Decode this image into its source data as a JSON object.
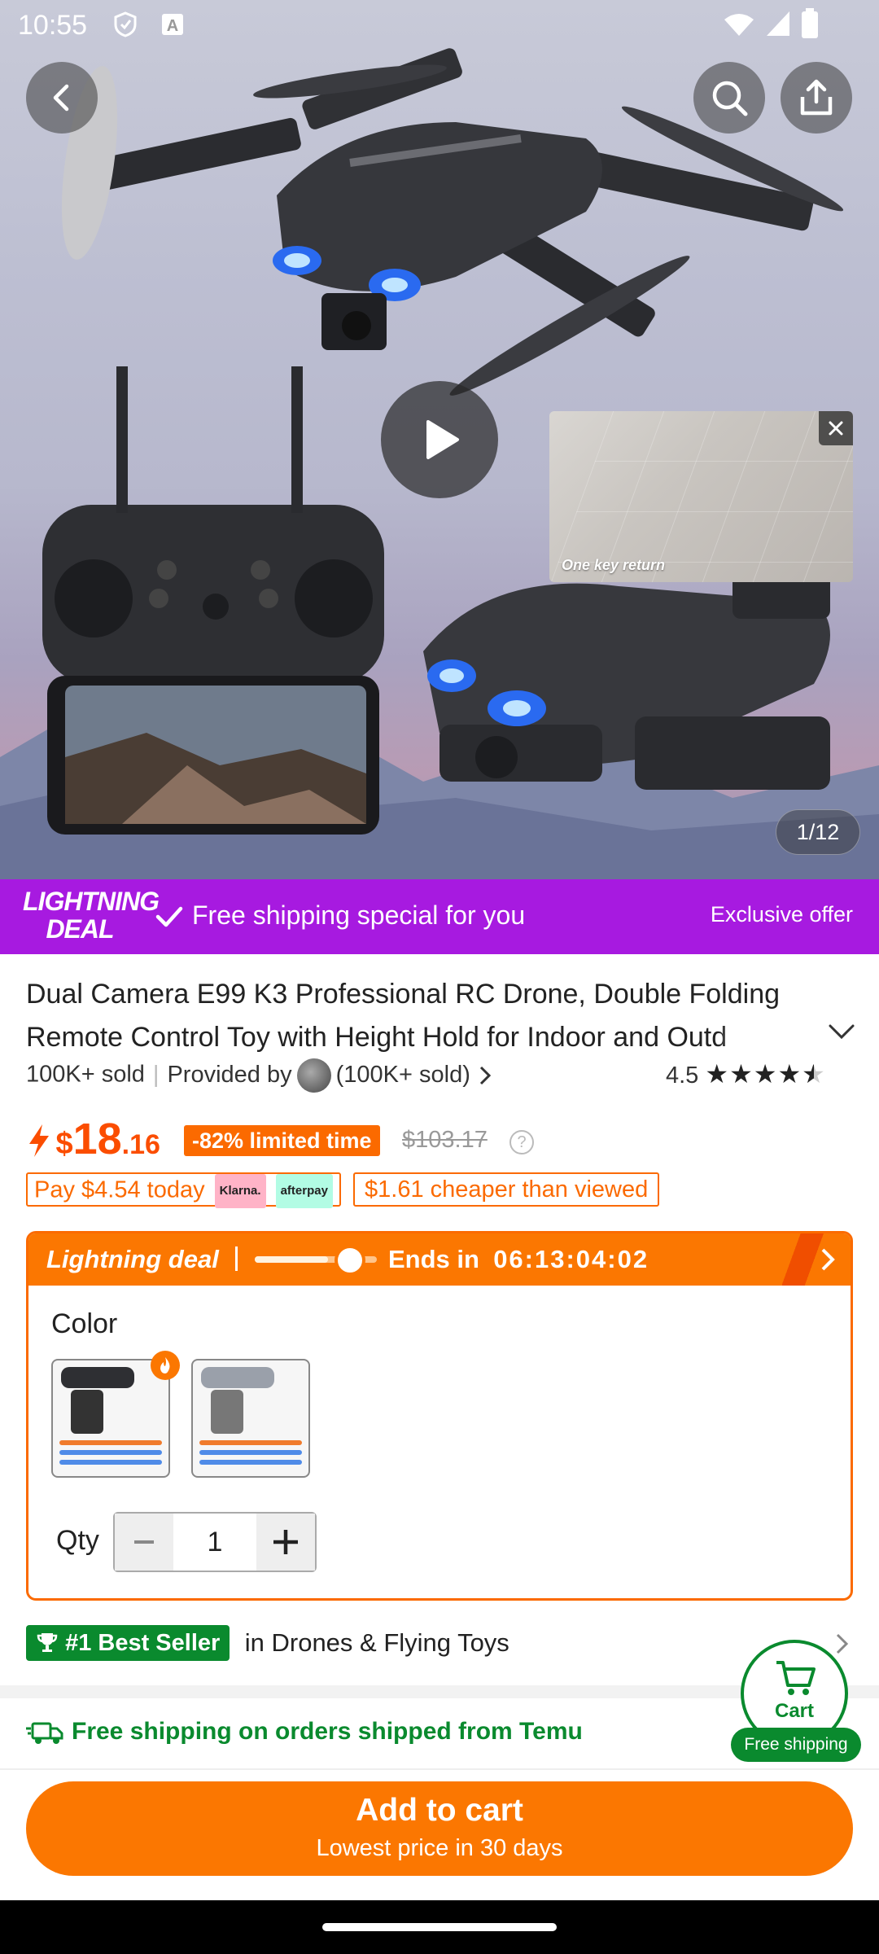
{
  "status_bar": {
    "time": "10:55"
  },
  "hero": {
    "mini_video_caption": "One key return",
    "image_counter": "1/12"
  },
  "banner": {
    "logo_line1": "LIGHTNING",
    "logo_line2": "DEAL",
    "message": "Free shipping special for you",
    "right_text": "Exclusive offer"
  },
  "product": {
    "title": "Dual Camera E99 K3 Professional RC Drone, Double Folding Remote Control Toy with Height Hold for Indoor and Outd",
    "sold": "100K+ sold",
    "provided_by": "Provided by",
    "seller_sold": "(100K+ sold)",
    "rating": "4.5",
    "rating_value": 4.5
  },
  "price": {
    "currency": "$",
    "integer": "18",
    "decimal": ".16",
    "discount": "-82% limited time",
    "old_price": "$103.17",
    "pay_today": "Pay $4.54 today",
    "klarna": "Klarna.",
    "afterpay": "afterpay",
    "cheaper": "$1.61 cheaper than viewed"
  },
  "deal": {
    "label": "Lightning deal",
    "ends_in": "Ends in",
    "countdown": "06:13:04:02",
    "progress": 0.6,
    "color_label": "Color",
    "qty_label": "Qty",
    "qty_value": "1"
  },
  "best_seller": {
    "badge": "#1 Best Seller",
    "category": "in Drones & Flying Toys"
  },
  "shipping": {
    "text": "Free shipping on orders shipped from Temu"
  },
  "cart_float": {
    "label": "Cart",
    "badge": "Free shipping"
  },
  "add_to_cart": {
    "label": "Add to cart",
    "sublabel": "Lowest price in 30 days"
  },
  "colors": {
    "accent": "#fb7701",
    "purple": "#a71ae0",
    "green": "#0a8a2e"
  }
}
